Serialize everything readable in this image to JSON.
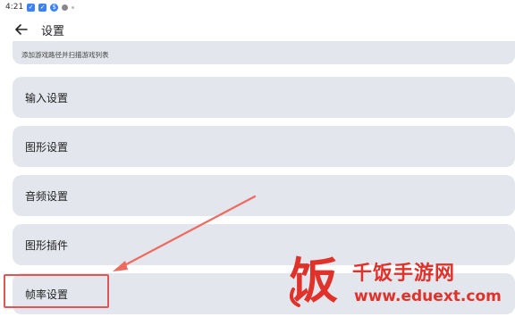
{
  "status_bar": {
    "time": "4:21",
    "icons": [
      "app-icon-blue",
      "app-icon-blue",
      "app-icon-blue",
      "notification-icon",
      "dot-icon"
    ]
  },
  "app_bar": {
    "title": "设置",
    "back_icon": "arrow-left-icon"
  },
  "partial_item": {
    "text": "添加游戏路径并扫描游戏列表"
  },
  "settings_items": [
    {
      "label": "输入设置"
    },
    {
      "label": "图形设置"
    },
    {
      "label": "音频设置"
    },
    {
      "label": "图形插件"
    },
    {
      "label": "帧率设置"
    }
  ],
  "watermark": {
    "logo_char": "饭",
    "title": "千饭手游网",
    "url": "www.eduext.com"
  },
  "colors": {
    "item_bg": "#e3e6ec",
    "highlight": "#e25555",
    "watermark": "#e0312a"
  }
}
